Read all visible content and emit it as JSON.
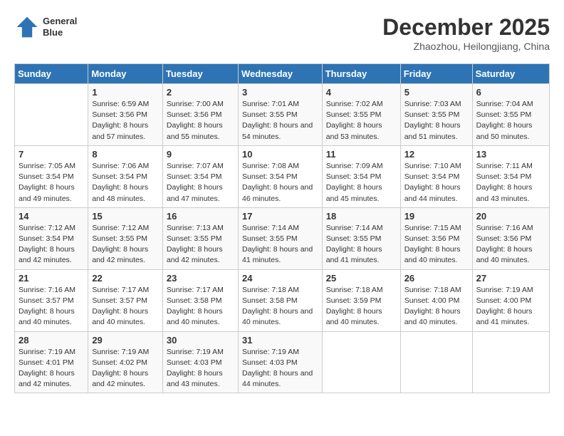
{
  "header": {
    "logo_line1": "General",
    "logo_line2": "Blue",
    "month": "December 2025",
    "location": "Zhaozhou, Heilongjiang, China"
  },
  "days_of_week": [
    "Sunday",
    "Monday",
    "Tuesday",
    "Wednesday",
    "Thursday",
    "Friday",
    "Saturday"
  ],
  "weeks": [
    [
      {
        "day": "",
        "sunrise": "",
        "sunset": "",
        "daylight": ""
      },
      {
        "day": "1",
        "sunrise": "Sunrise: 6:59 AM",
        "sunset": "Sunset: 3:56 PM",
        "daylight": "Daylight: 8 hours and 57 minutes."
      },
      {
        "day": "2",
        "sunrise": "Sunrise: 7:00 AM",
        "sunset": "Sunset: 3:56 PM",
        "daylight": "Daylight: 8 hours and 55 minutes."
      },
      {
        "day": "3",
        "sunrise": "Sunrise: 7:01 AM",
        "sunset": "Sunset: 3:55 PM",
        "daylight": "Daylight: 8 hours and 54 minutes."
      },
      {
        "day": "4",
        "sunrise": "Sunrise: 7:02 AM",
        "sunset": "Sunset: 3:55 PM",
        "daylight": "Daylight: 8 hours and 53 minutes."
      },
      {
        "day": "5",
        "sunrise": "Sunrise: 7:03 AM",
        "sunset": "Sunset: 3:55 PM",
        "daylight": "Daylight: 8 hours and 51 minutes."
      },
      {
        "day": "6",
        "sunrise": "Sunrise: 7:04 AM",
        "sunset": "Sunset: 3:55 PM",
        "daylight": "Daylight: 8 hours and 50 minutes."
      }
    ],
    [
      {
        "day": "7",
        "sunrise": "Sunrise: 7:05 AM",
        "sunset": "Sunset: 3:54 PM",
        "daylight": "Daylight: 8 hours and 49 minutes."
      },
      {
        "day": "8",
        "sunrise": "Sunrise: 7:06 AM",
        "sunset": "Sunset: 3:54 PM",
        "daylight": "Daylight: 8 hours and 48 minutes."
      },
      {
        "day": "9",
        "sunrise": "Sunrise: 7:07 AM",
        "sunset": "Sunset: 3:54 PM",
        "daylight": "Daylight: 8 hours and 47 minutes."
      },
      {
        "day": "10",
        "sunrise": "Sunrise: 7:08 AM",
        "sunset": "Sunset: 3:54 PM",
        "daylight": "Daylight: 8 hours and 46 minutes."
      },
      {
        "day": "11",
        "sunrise": "Sunrise: 7:09 AM",
        "sunset": "Sunset: 3:54 PM",
        "daylight": "Daylight: 8 hours and 45 minutes."
      },
      {
        "day": "12",
        "sunrise": "Sunrise: 7:10 AM",
        "sunset": "Sunset: 3:54 PM",
        "daylight": "Daylight: 8 hours and 44 minutes."
      },
      {
        "day": "13",
        "sunrise": "Sunrise: 7:11 AM",
        "sunset": "Sunset: 3:54 PM",
        "daylight": "Daylight: 8 hours and 43 minutes."
      }
    ],
    [
      {
        "day": "14",
        "sunrise": "Sunrise: 7:12 AM",
        "sunset": "Sunset: 3:54 PM",
        "daylight": "Daylight: 8 hours and 42 minutes."
      },
      {
        "day": "15",
        "sunrise": "Sunrise: 7:12 AM",
        "sunset": "Sunset: 3:55 PM",
        "daylight": "Daylight: 8 hours and 42 minutes."
      },
      {
        "day": "16",
        "sunrise": "Sunrise: 7:13 AM",
        "sunset": "Sunset: 3:55 PM",
        "daylight": "Daylight: 8 hours and 42 minutes."
      },
      {
        "day": "17",
        "sunrise": "Sunrise: 7:14 AM",
        "sunset": "Sunset: 3:55 PM",
        "daylight": "Daylight: 8 hours and 41 minutes."
      },
      {
        "day": "18",
        "sunrise": "Sunrise: 7:14 AM",
        "sunset": "Sunset: 3:55 PM",
        "daylight": "Daylight: 8 hours and 41 minutes."
      },
      {
        "day": "19",
        "sunrise": "Sunrise: 7:15 AM",
        "sunset": "Sunset: 3:56 PM",
        "daylight": "Daylight: 8 hours and 40 minutes."
      },
      {
        "day": "20",
        "sunrise": "Sunrise: 7:16 AM",
        "sunset": "Sunset: 3:56 PM",
        "daylight": "Daylight: 8 hours and 40 minutes."
      }
    ],
    [
      {
        "day": "21",
        "sunrise": "Sunrise: 7:16 AM",
        "sunset": "Sunset: 3:57 PM",
        "daylight": "Daylight: 8 hours and 40 minutes."
      },
      {
        "day": "22",
        "sunrise": "Sunrise: 7:17 AM",
        "sunset": "Sunset: 3:57 PM",
        "daylight": "Daylight: 8 hours and 40 minutes."
      },
      {
        "day": "23",
        "sunrise": "Sunrise: 7:17 AM",
        "sunset": "Sunset: 3:58 PM",
        "daylight": "Daylight: 8 hours and 40 minutes."
      },
      {
        "day": "24",
        "sunrise": "Sunrise: 7:18 AM",
        "sunset": "Sunset: 3:58 PM",
        "daylight": "Daylight: 8 hours and 40 minutes."
      },
      {
        "day": "25",
        "sunrise": "Sunrise: 7:18 AM",
        "sunset": "Sunset: 3:59 PM",
        "daylight": "Daylight: 8 hours and 40 minutes."
      },
      {
        "day": "26",
        "sunrise": "Sunrise: 7:18 AM",
        "sunset": "Sunset: 4:00 PM",
        "daylight": "Daylight: 8 hours and 40 minutes."
      },
      {
        "day": "27",
        "sunrise": "Sunrise: 7:19 AM",
        "sunset": "Sunset: 4:00 PM",
        "daylight": "Daylight: 8 hours and 41 minutes."
      }
    ],
    [
      {
        "day": "28",
        "sunrise": "Sunrise: 7:19 AM",
        "sunset": "Sunset: 4:01 PM",
        "daylight": "Daylight: 8 hours and 42 minutes."
      },
      {
        "day": "29",
        "sunrise": "Sunrise: 7:19 AM",
        "sunset": "Sunset: 4:02 PM",
        "daylight": "Daylight: 8 hours and 42 minutes."
      },
      {
        "day": "30",
        "sunrise": "Sunrise: 7:19 AM",
        "sunset": "Sunset: 4:03 PM",
        "daylight": "Daylight: 8 hours and 43 minutes."
      },
      {
        "day": "31",
        "sunrise": "Sunrise: 7:19 AM",
        "sunset": "Sunset: 4:03 PM",
        "daylight": "Daylight: 8 hours and 44 minutes."
      },
      {
        "day": "",
        "sunrise": "",
        "sunset": "",
        "daylight": ""
      },
      {
        "day": "",
        "sunrise": "",
        "sunset": "",
        "daylight": ""
      },
      {
        "day": "",
        "sunrise": "",
        "sunset": "",
        "daylight": ""
      }
    ]
  ]
}
